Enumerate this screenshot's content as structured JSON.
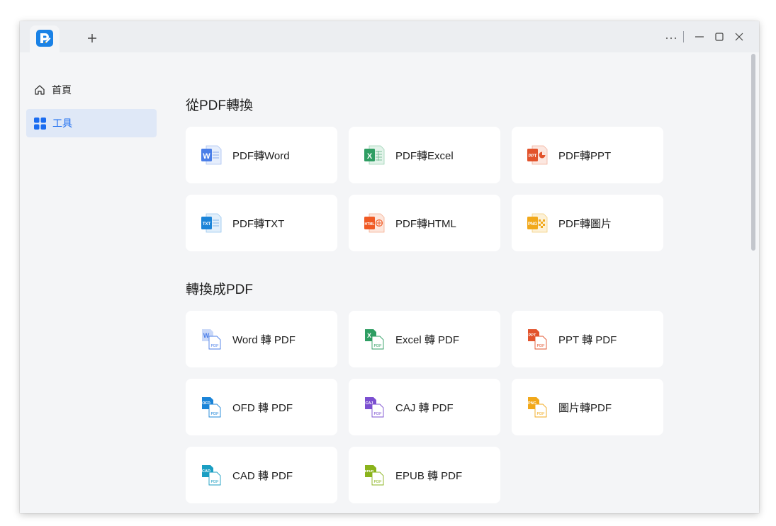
{
  "sidebar": {
    "items": [
      {
        "label": "首頁",
        "icon": "home-icon"
      },
      {
        "label": "工具",
        "icon": "grid-tools-icon",
        "active": true
      }
    ]
  },
  "from_pdf": {
    "title": "從PDF轉換",
    "tools": [
      {
        "label": "PDF轉Word",
        "icon": "word-icon",
        "color": "#4a7ee8"
      },
      {
        "label": "PDF轉Excel",
        "icon": "excel-icon",
        "color": "#2f9e63"
      },
      {
        "label": "PDF轉PPT",
        "icon": "ppt-icon",
        "color": "#e2532c"
      },
      {
        "label": "PDF轉TXT",
        "icon": "txt-icon",
        "color": "#1b84d8"
      },
      {
        "label": "PDF轉HTML",
        "icon": "html-icon",
        "color": "#f05a24"
      },
      {
        "label": "PDF轉圖片",
        "icon": "image-icon",
        "color": "#f1a81a"
      }
    ]
  },
  "to_pdf": {
    "title": "轉換成PDF",
    "tools": [
      {
        "label": "Word 轉 PDF",
        "icon": "word-to-pdf-icon",
        "color": "#4a7ee8"
      },
      {
        "label": "Excel 轉 PDF",
        "icon": "excel-to-pdf-icon",
        "color": "#2f9e63"
      },
      {
        "label": "PPT 轉 PDF",
        "icon": "ppt-to-pdf-icon",
        "color": "#e2532c"
      },
      {
        "label": "OFD 轉 PDF",
        "icon": "ofd-to-pdf-icon",
        "color": "#1b84d8"
      },
      {
        "label": "CAJ 轉 PDF",
        "icon": "caj-to-pdf-icon",
        "color": "#7b4fd0"
      },
      {
        "label": "圖片轉PDF",
        "icon": "image-to-pdf-icon",
        "color": "#f1a81a"
      },
      {
        "label": "CAD 轉 PDF",
        "icon": "cad-to-pdf-icon",
        "color": "#1a9ec2"
      },
      {
        "label": "EPUB 轉 PDF",
        "icon": "epub-to-pdf-icon",
        "color": "#8ab31c"
      }
    ]
  },
  "icon_text": {
    "word": "W",
    "excel": "X",
    "ppt": "PPT",
    "txt": "TXT",
    "html": "HTML",
    "png": "PNG",
    "ofd": "OFD",
    "caj": "CAJ",
    "cad": "CAD",
    "epub": "EPUB",
    "pdf": "PDF"
  },
  "colors": {
    "accent": "#1a6cf0",
    "active_bg": "#dfe8f7",
    "logo": "#1a82e6"
  }
}
